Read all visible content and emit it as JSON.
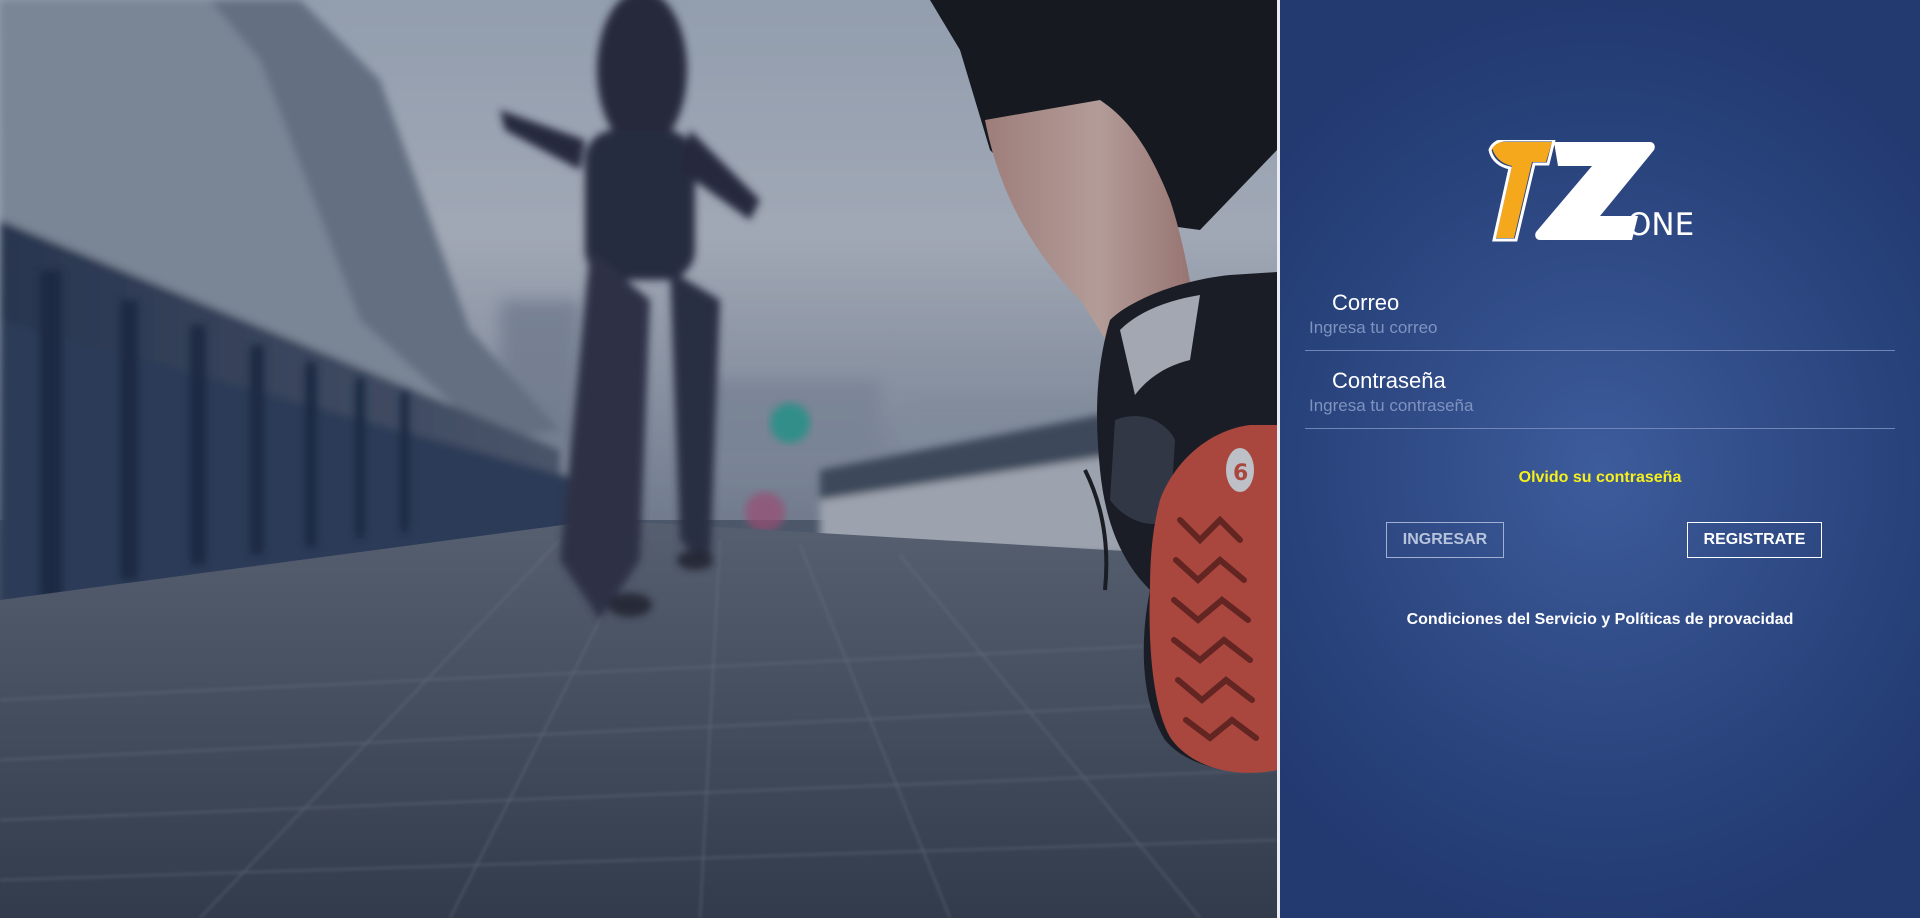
{
  "hero": {
    "image_alt": "Runner on a paved bridge path, close-up of running shoe"
  },
  "brand": {
    "logo_icon": "tz-logo-icon",
    "logo_suffix": "ONE",
    "accent_color": "#f5a81c"
  },
  "form": {
    "email": {
      "label": "Correo",
      "placeholder": "Ingresa tu correo",
      "value": ""
    },
    "password": {
      "label": "Contraseña",
      "placeholder": "Ingresa tu contraseña",
      "value": ""
    },
    "forgot_password": "Olvido su contraseña",
    "login_button": "INGRESAR",
    "register_button": "REGISTRATE",
    "terms_link": "Condiciones del Servicio y Políticas de provacidad"
  },
  "colors": {
    "panel_background": "#2d4a86",
    "forgot_link": "#f7f01c",
    "text": "#ffffff"
  }
}
